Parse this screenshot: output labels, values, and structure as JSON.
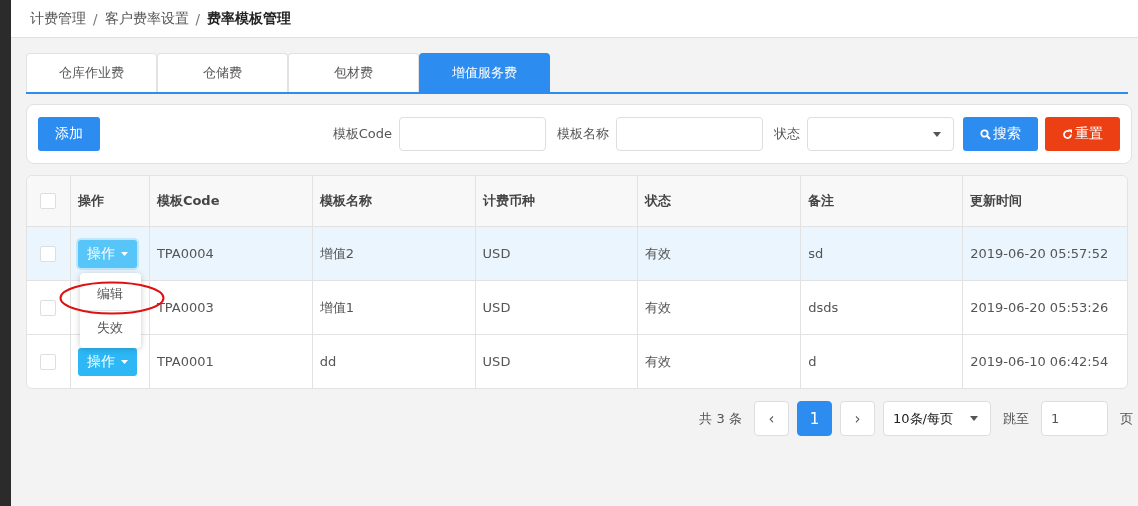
{
  "breadcrumb": [
    "计费管理",
    "客户费率设置",
    "费率模板管理"
  ],
  "breadcrumb_separator": "/",
  "tabs": [
    {
      "label": "仓库作业费",
      "selected": false
    },
    {
      "label": "仓储费",
      "selected": false
    },
    {
      "label": "包材费",
      "selected": false
    },
    {
      "label": "增值服务费",
      "selected": true
    }
  ],
  "toolbar": {
    "add_button": "添加",
    "filters": [
      {
        "kind": "input",
        "label": "模板Code"
      },
      {
        "kind": "input",
        "label": "模板名称"
      },
      {
        "kind": "select",
        "label": "状态"
      }
    ],
    "search_button": "搜索",
    "reset_button": "重置"
  },
  "table": {
    "header_checked": false,
    "columns": [
      "操作",
      "模板Code",
      "模板名称",
      "计费币种",
      "状态",
      "备注",
      "更新时间"
    ],
    "rows": [
      {
        "selected": true,
        "checked": false,
        "menu_open": true,
        "cells": [
          "操作",
          "TPA0004",
          "增值2",
          "USD",
          "有效",
          "sd",
          "2019-06-20 05:57:52"
        ]
      },
      {
        "selected": false,
        "checked": false,
        "menu_open": false,
        "cells": [
          "",
          "TPA0003",
          "增值1",
          "USD",
          "有效",
          "dsds",
          "2019-06-20 05:53:26"
        ]
      },
      {
        "selected": false,
        "checked": false,
        "menu_open": false,
        "cells": [
          "操作",
          "TPA0001",
          "dd",
          "USD",
          "有效",
          "d",
          "2019-06-10 06:42:54"
        ]
      }
    ],
    "action_menu": {
      "items": [
        {
          "label": "编辑",
          "circled": true
        },
        {
          "label": "失效",
          "circled": false
        }
      ]
    }
  },
  "pagination": {
    "total": "共 3 条",
    "prev": "‹",
    "pages": [
      {
        "label": "1",
        "selected": true
      }
    ],
    "next": "›",
    "page_size": "10条/每页",
    "jump_label": "跳至",
    "jump_value": "1",
    "page_suffix": "页"
  }
}
